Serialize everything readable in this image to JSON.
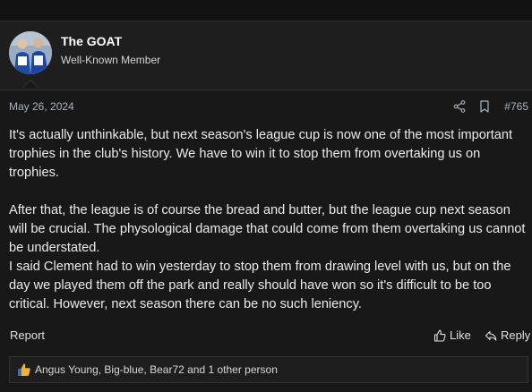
{
  "post": {
    "author": {
      "name": "The GOAT",
      "title": "Well-Known Member"
    },
    "date": "May 26, 2024",
    "number": "#765",
    "paragraphs": [
      "It's actually unthinkable, but next season's league cup is now one of the most important trophies in the club's history. We have to win it to stop them from overtaking us on trophies.",
      "After that, the league is of course the bread and butter, but the league cup next season will be crucial. The physological damage that could come from them overtaking us cannot be understated.",
      "I said Clement had to win yesterday to stop them from drawing level with us, but on the day we played them off the park and really should have won so it's difficult to be too critical. However, next season there can be no such leniency."
    ],
    "actions": {
      "report": "Report",
      "like": "Like",
      "reply": "Reply"
    },
    "reactions_text": "Angus Young, Big-blue, Bear72 and 1 other person"
  },
  "icons": {
    "share": "share-icon",
    "bookmark": "bookmark-icon",
    "like": "thumbs-up-icon",
    "reply": "reply-icon",
    "reaction": "thumbs-up-emoji-icon"
  },
  "colors": {
    "background": "#181818",
    "header_background": "#1e1e1e",
    "meta_text": "#a8b3bf",
    "reaction_emoji": "#f2b233"
  }
}
